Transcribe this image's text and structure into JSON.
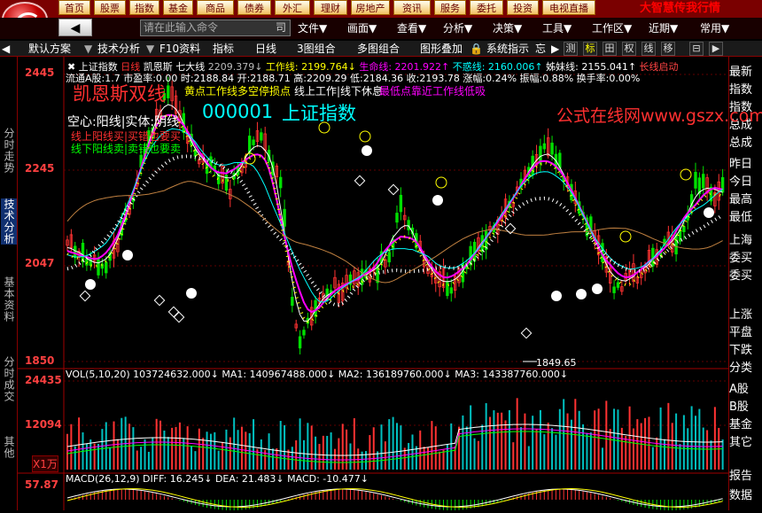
{
  "topmenu": [
    "首页",
    "股票",
    "指数",
    "基金",
    "商品",
    "债券",
    "外汇",
    "理财",
    "房地产",
    "资讯",
    "服务",
    "委托",
    "投资",
    "电视直播"
  ],
  "brand": "大智慧传我行情",
  "search": {
    "placeholder": "请在此输入命令",
    "tag": "司"
  },
  "mainmenu": [
    "文件▼",
    "画面▼",
    "查看▼",
    "分析▼",
    "决策▼",
    "工具▼",
    "工作区▼",
    "近期▼",
    "常用▼"
  ],
  "toolbar": {
    "scheme": "默认方案",
    "tech": "技术分析",
    "f10": "F10资料",
    "indicator": "指标",
    "period": "日线",
    "grid3": "3图组合",
    "multi": "多图组合",
    "overlay": "图形叠加",
    "system": "系统指示",
    "more": "忘"
  },
  "toolicons": [
    "测",
    "标",
    "田",
    "权",
    "线",
    "移"
  ],
  "lefttabs": [
    "分时走势",
    "技术分析",
    "基本资料",
    "分时成交",
    "其他"
  ],
  "righttabs": [
    "最新",
    "指数",
    "指数",
    "总成",
    "总成",
    "昨日",
    "今日",
    "最高",
    "最低",
    "上海",
    "委买",
    "委买",
    "上涨",
    "平盘",
    "下跌",
    "分类",
    "A股",
    "B股",
    "基金",
    "其它",
    "报告",
    "数据"
  ],
  "info1": {
    "name": "上证指数",
    "period": "日线",
    "indicator": "凯恩斯 七大线",
    "l1": "2209.379↓",
    "gz": "工作线: 2199.764↓",
    "sm": "生命线: 2201.922↑",
    "bhx": "不惑线: 2160.006↑",
    "zm": "姊妹线: 2155.041↑",
    "cx": "长线启动"
  },
  "info2": "流通A股:1.7  市盈率:0.00  时:2188.84  开:2188.71  高:2209.29  低:2184.36  收:2193.78  涨幅:0.24%  振幅:0.88%  换手率:0.00%",
  "legend": {
    "title": "凯恩斯双线",
    "l1": "黄点工作线多空停损点",
    "l2": "线上工作|线下休息",
    "l3": "最低点靠近工作线低吸",
    "code": "000001",
    "name": "上证指数",
    "kstyle": "空心:阳线|实体:阴线",
    "up": "线上阳线买|买错也要买",
    "down": "线下阳线卖|卖错也要卖",
    "watermark": "公式在线网www.gszx.com.cn"
  },
  "price_labels": [
    "2445",
    "2245",
    "2047",
    "1850"
  ],
  "low_label": "1849.65",
  "vol": {
    "header": "VOL(5,10,20)  103724632.000↓  MA1: 140967488.000↓  MA2: 136189760.000↓  MA3: 143387760.000↓",
    "top": "24435",
    "mid": "12094",
    "unit": "X1万"
  },
  "macd": {
    "header": "MACD(26,12,9)  DIFF: 16.245↓  DEA: 21.483↓  MACD: -10.477↓",
    "top": "57.87"
  },
  "chart_data": {
    "type": "candlestick",
    "ylim": [
      1850,
      2445
    ],
    "low": 1849.65,
    "last": {
      "open": 2188.71,
      "high": 2209.29,
      "low": 2184.36,
      "close": 2193.78
    }
  }
}
